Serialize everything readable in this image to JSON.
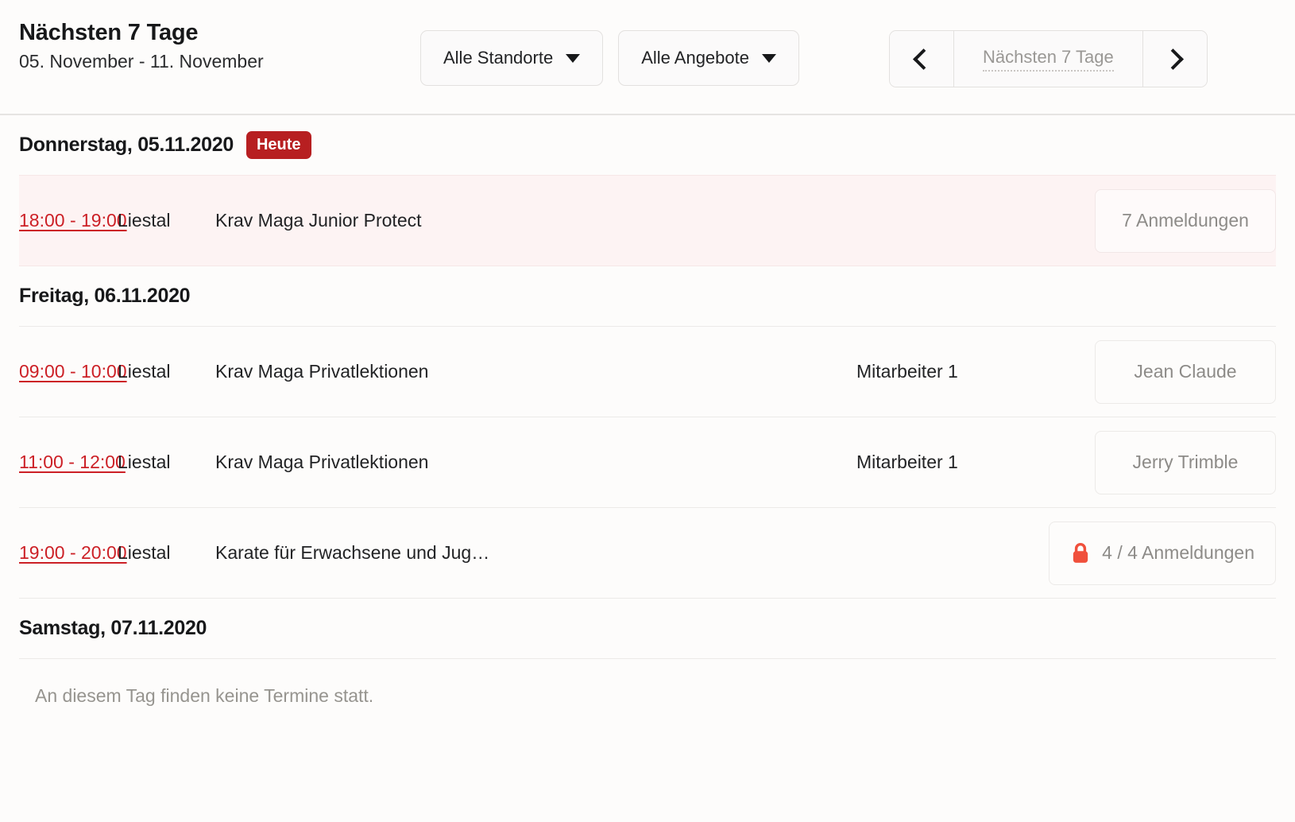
{
  "header": {
    "title": "Nächsten 7 Tage",
    "subtitle": "05. November - 11. November",
    "filters": [
      {
        "name": "location-filter",
        "label": "Alle Standorte"
      },
      {
        "name": "offer-filter",
        "label": "Alle Angebote"
      }
    ],
    "pager": {
      "prev_icon": "chevron-left-icon",
      "next_icon": "chevron-right-icon",
      "label": "Nächsten 7 Tage"
    }
  },
  "days": [
    {
      "title": "Donnerstag, 05.11.2020",
      "badge": "Heute",
      "is_today": true,
      "empty_text": null,
      "rows": [
        {
          "time": "18:00 - 19:00",
          "location": "Liestal",
          "name": "Krav Maga Junior Protect",
          "staff": "",
          "action_label": "7 Anmeldungen",
          "locked": false
        }
      ]
    },
    {
      "title": "Freitag, 06.11.2020",
      "badge": null,
      "is_today": false,
      "empty_text": null,
      "rows": [
        {
          "time": "09:00 - 10:00",
          "location": "Liestal",
          "name": "Krav Maga Privatlektionen",
          "staff": "Mitarbeiter 1",
          "action_label": "Jean Claude",
          "locked": false
        },
        {
          "time": "11:00 - 12:00",
          "location": "Liestal",
          "name": "Krav Maga Privatlektionen",
          "staff": "Mitarbeiter 1",
          "action_label": "Jerry Trimble",
          "locked": false
        },
        {
          "time": "19:00 - 20:00",
          "location": "Liestal",
          "name": "Karate für Erwachsene und Jug…",
          "staff": "",
          "action_label": "4 / 4 Anmeldungen",
          "locked": true
        }
      ]
    },
    {
      "title": "Samstag, 07.11.2020",
      "badge": null,
      "is_today": false,
      "empty_text": "An diesem Tag finden keine Termine statt.",
      "rows": []
    }
  ],
  "colors": {
    "accent_red": "#cc2026",
    "badge_red": "#b71f21",
    "lock_red": "#f0503c",
    "today_row_bg": "#fdf3f3",
    "page_bg": "#fdfcfb",
    "muted_text": "#8d8b88"
  }
}
